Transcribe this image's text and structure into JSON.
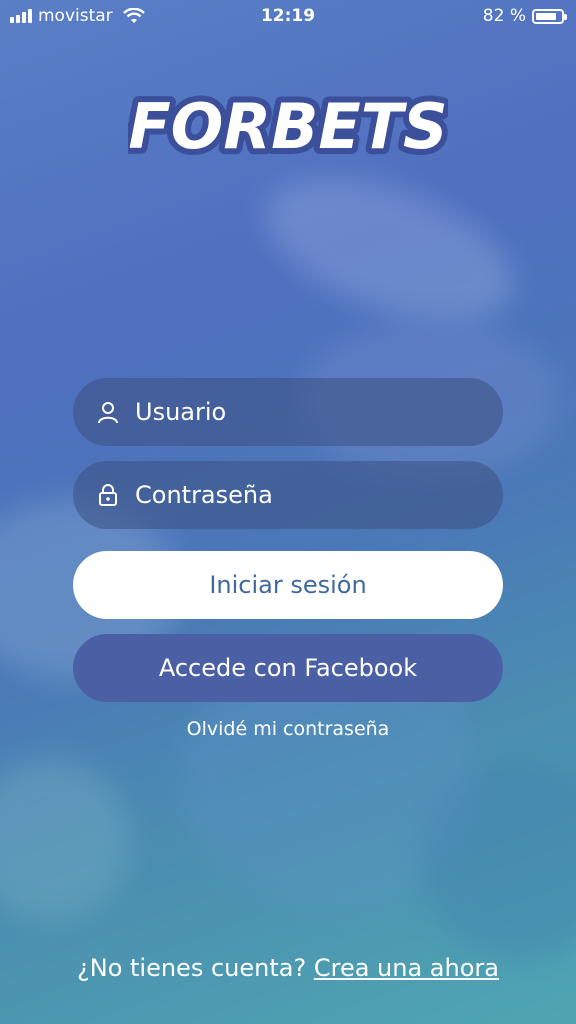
{
  "status_bar": {
    "carrier": "movistar",
    "time": "12:19",
    "battery_text": "82 %",
    "battery_level": 0.82
  },
  "logo": {
    "text": "FORBETS"
  },
  "form": {
    "username_placeholder": "Usuario",
    "password_placeholder": "Contraseña",
    "login_label": "Iniciar sesión",
    "facebook_label": "Accede con Facebook",
    "forgot_label": "Olvidé mi contraseña"
  },
  "signup": {
    "prompt": "¿No tienes cuenta?",
    "link_label": "Crea una ahora"
  },
  "icons": {
    "signal": "cellular-signal-icon",
    "wifi": "wifi-icon",
    "battery": "battery-icon",
    "user": "user-icon",
    "lock": "lock-icon"
  },
  "colors": {
    "login_text": "#3f6aa0",
    "facebook_bg": "#4b5fa5",
    "field_bg": "rgba(60,80,130,0.55)"
  }
}
